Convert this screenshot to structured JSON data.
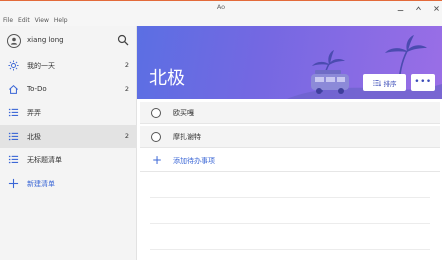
{
  "window": {
    "title": "Ao"
  },
  "menu": [
    "File",
    "Edit",
    "View",
    "Help"
  ],
  "user": {
    "name": "xiang long"
  },
  "sidebar": {
    "items": [
      {
        "label": "我的一天",
        "count": "2",
        "icon": "sun-icon"
      },
      {
        "label": "To-Do",
        "count": "2",
        "icon": "home-icon"
      },
      {
        "label": "弄弄",
        "count": "",
        "icon": "list-icon"
      },
      {
        "label": "北极",
        "count": "2",
        "icon": "list-icon",
        "active": true
      },
      {
        "label": "无标题清单",
        "count": "",
        "icon": "list-icon"
      }
    ],
    "new_list": "新建清单"
  },
  "main": {
    "title": "北极",
    "sort_label": "排序",
    "more_label": "•••",
    "tasks": [
      {
        "title": "欧买嘎"
      },
      {
        "title": "摩扎谢特"
      }
    ],
    "add_task": "添加待办事项"
  },
  "colors": {
    "accent": "#3a66d6",
    "banner_start": "#5b6fe3",
    "banner_end": "#9a6ee6"
  }
}
